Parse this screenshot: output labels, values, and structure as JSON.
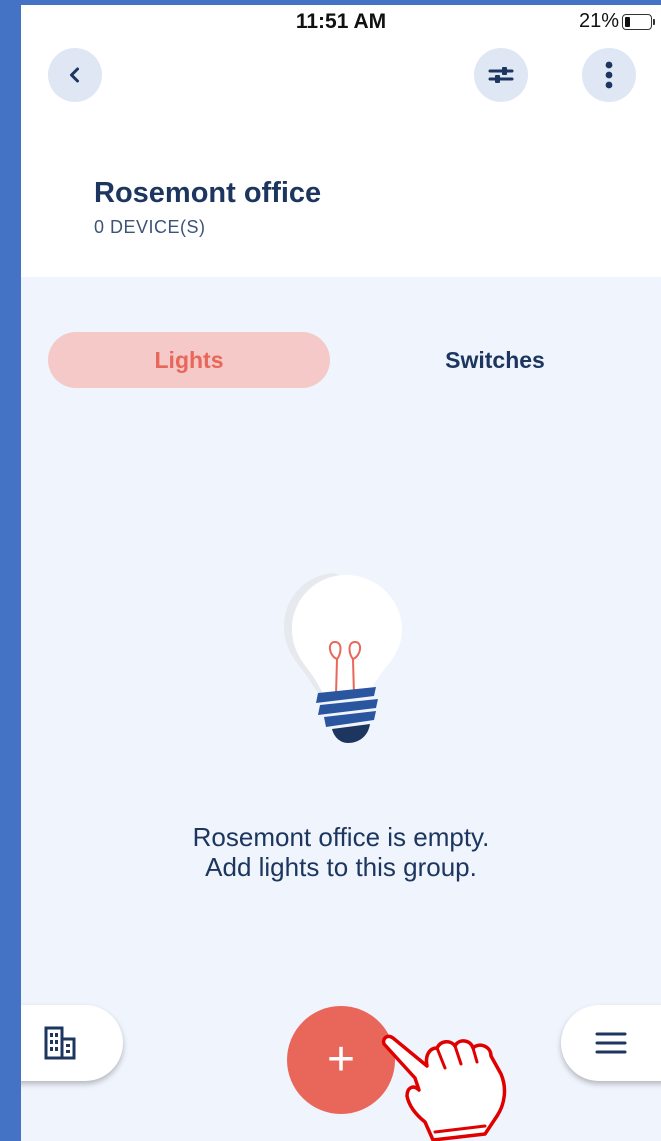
{
  "status_bar": {
    "time": "11:51 AM",
    "battery": "21%",
    "battery_level": 0.21
  },
  "header": {
    "back_icon": "chevron-left-icon",
    "filter_icon": "sliders-icon",
    "more_icon": "more-vertical-icon"
  },
  "group": {
    "title": "Rosemont office",
    "device_count": "0 DEVICE(S)"
  },
  "tabs": [
    {
      "label": "Lights",
      "active": true
    },
    {
      "label": "Switches",
      "active": false
    }
  ],
  "empty_state": {
    "line1": "Rosemont office is empty.",
    "line2": "Add lights to this group.",
    "icon": "lightbulb-icon"
  },
  "bottom_nav": {
    "left_icon": "building-icon",
    "fab_label": "+",
    "right_icon": "menu-icon"
  },
  "colors": {
    "accent": "#e8675a",
    "navy": "#1c3660",
    "tab_active_bg": "#f4c9c7",
    "content_bg": "#f0f4fc",
    "frame": "#4472c4",
    "annotation": "#e00000"
  }
}
